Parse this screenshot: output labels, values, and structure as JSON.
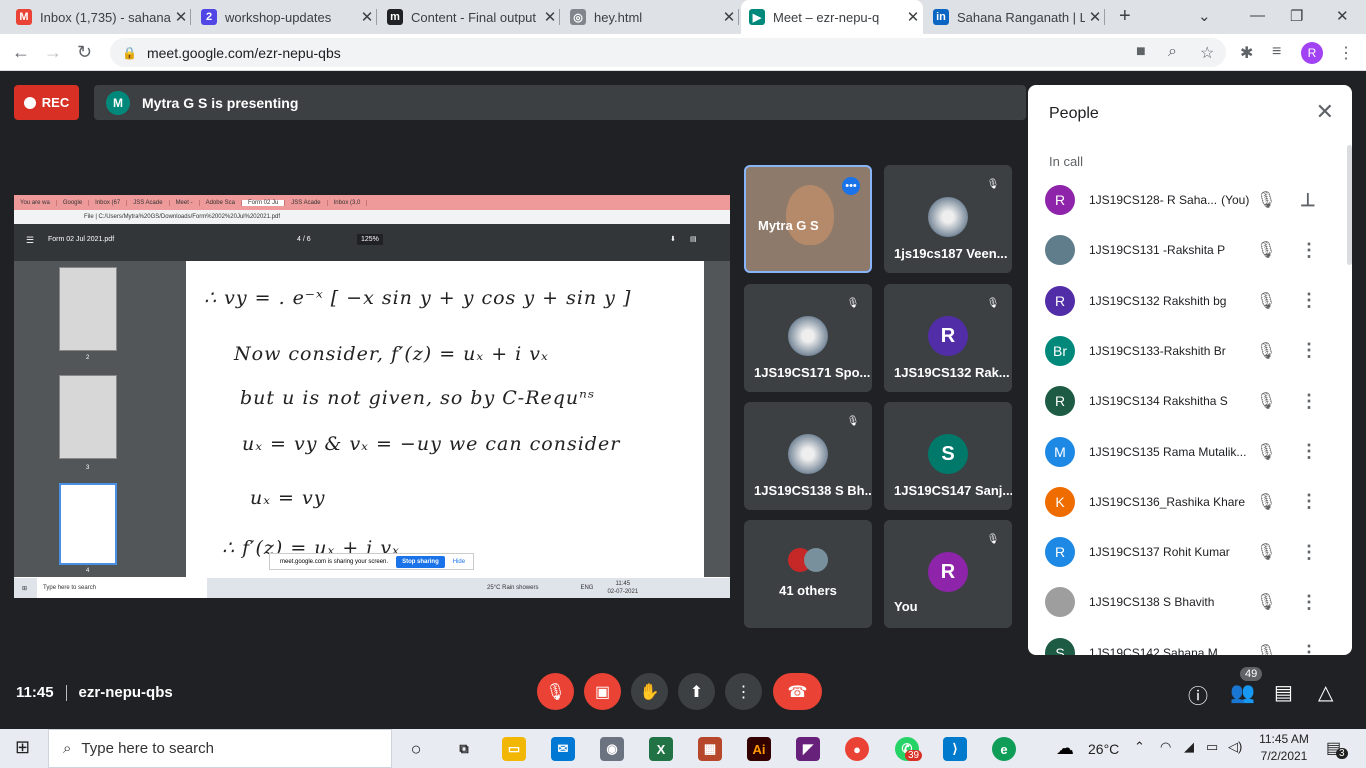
{
  "browser": {
    "tabs": [
      {
        "title": "Inbox (1,735) - sahana",
        "icon": "gmail-icon",
        "color": "#ea4335",
        "glyph": "M"
      },
      {
        "title": "workshop-updates",
        "icon": "app-icon",
        "color": "#4f46e5",
        "glyph": "2"
      },
      {
        "title": "Content - Final output",
        "icon": "m-icon",
        "color": "#202124",
        "glyph": "m"
      },
      {
        "title": "hey.html",
        "icon": "globe-icon",
        "color": "#80868b",
        "glyph": "◎"
      },
      {
        "title": "Meet – ezr-nepu-q",
        "icon": "meet-icon",
        "color": "#00897b",
        "glyph": "▶",
        "active": true
      },
      {
        "title": "Sahana Ranganath | Li",
        "icon": "linkedin-icon",
        "color": "#0a66c2",
        "glyph": "in"
      }
    ],
    "new_tab": "+",
    "url": "meet.google.com/ezr-nepu-qbs",
    "profile_initial": "R"
  },
  "meet": {
    "rec_label": "REC",
    "presenting_initial": "M",
    "presenting_text": "Mytra G S is presenting",
    "shared_screen": {
      "tabs": [
        "You are wa",
        "Google",
        "Inbox (67",
        "JSS Acade",
        "Meet -",
        "Adobe Sca",
        "Form 02 Ju",
        "JSS Acade",
        "Inbox (3,0"
      ],
      "url": "File | C:/Users/Mytra%20GS/Downloads/Form%2002%20Jul%202021.pdf",
      "pdf_title": "Form 02 Jul 2021.pdf",
      "page": "4 / 6",
      "zoom": "125%",
      "thumbs": [
        "2",
        "3",
        "4"
      ],
      "lines": [
        "∴ vy = . e⁻ˣ [ −x sin y + y cos y + sin y ]",
        "Now consider, f′(z) = uₓ + i vₓ",
        "but u is not given, so by C-Requⁿˢ",
        "uₓ = vy  &  vₓ = −uy   we can consider",
        "uₓ = vy",
        "∴ f′(z) = uₓ + i vₓ"
      ],
      "sharing_text": "meet.google.com is sharing your screen.",
      "stop_sharing": "Stop sharing",
      "hide": "Hide",
      "search": "Type here to search",
      "weather": "25°C  Rain showers",
      "lang": "ENG",
      "time": "11:45",
      "date": "02-07-2021"
    },
    "tiles": [
      {
        "name": "Mytra G S",
        "kind": "video"
      },
      {
        "name": "1js19cs187 Veen...",
        "kind": "photo",
        "muted": true
      },
      {
        "name": "1JS19CS171 Spo...",
        "kind": "photo",
        "muted": true
      },
      {
        "name": "1JS19CS132 Rak...",
        "kind": "letter",
        "initial": "R",
        "color": "#512da8",
        "muted": true
      },
      {
        "name": "1JS19CS138 S Bh...",
        "kind": "photo",
        "muted": true
      },
      {
        "name": "1JS19CS147 Sanj...",
        "kind": "letter",
        "initial": "S",
        "color": "#00796b"
      },
      {
        "name": "41 others",
        "kind": "others"
      },
      {
        "name": "You",
        "kind": "letter",
        "initial": "R",
        "color": "#8e24aa",
        "muted": true
      }
    ],
    "people": {
      "title": "People",
      "section": "In call",
      "rows": [
        {
          "initial": "R",
          "color": "#8e24aa",
          "name": "1JS19CS128- R Saha...",
          "you": "(You)"
        },
        {
          "initial": "",
          "color": "#607d8b",
          "name": "1JS19CS131 -Rakshita P"
        },
        {
          "initial": "R",
          "color": "#512da8",
          "name": "1JS19CS132 Rakshith bg"
        },
        {
          "initial": "Br",
          "color": "#00897b",
          "name": "1JS19CS133-Rakshith Br"
        },
        {
          "initial": "R",
          "color": "#1e5b45",
          "name": "1JS19CS134 Rakshitha S"
        },
        {
          "initial": "M",
          "color": "#1e88e5",
          "name": "1JS19CS135 Rama Mutalik..."
        },
        {
          "initial": "K",
          "color": "#ef6c00",
          "name": "1JS19CS136_Rashika Khare"
        },
        {
          "initial": "R",
          "color": "#1e88e5",
          "name": "1JS19CS137 Rohit Kumar"
        },
        {
          "initial": "",
          "color": "#9e9e9e",
          "name": "1JS19CS138 S Bhavith"
        },
        {
          "initial": "S",
          "color": "#1e5b45",
          "name": "1JS19CS142 Sahana M"
        }
      ]
    },
    "time": "11:45",
    "meeting_code": "ezr-nepu-qbs",
    "people_count": "49"
  },
  "taskbar": {
    "search_placeholder": "Type here to search",
    "weather": "26°C",
    "time": "11:45 AM",
    "date": "7/2/2021",
    "whatsapp_badge": "39",
    "notifications": "3"
  }
}
